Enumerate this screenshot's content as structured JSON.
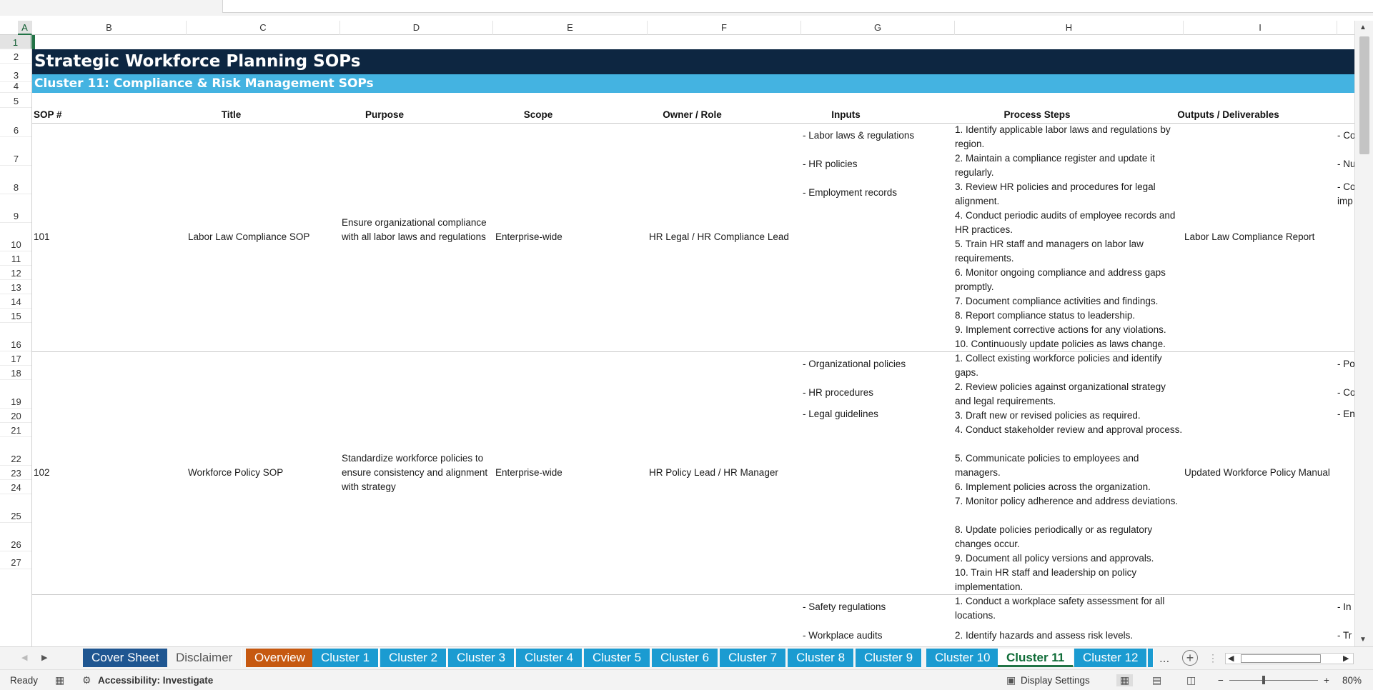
{
  "columns": [
    "A",
    "B",
    "C",
    "D",
    "E",
    "F",
    "G",
    "H",
    "I"
  ],
  "rows": [
    "1",
    "2",
    "3",
    "4",
    "5",
    "6",
    "7",
    "8",
    "9",
    "10",
    "11",
    "12",
    "13",
    "14",
    "15",
    "16",
    "17",
    "18",
    "19",
    "20",
    "21",
    "22",
    "23",
    "24",
    "25",
    "26",
    "27"
  ],
  "sheet": {
    "title": "Strategic Workforce Planning SOPs",
    "subtitle": "Cluster 11: Compliance & Risk Management SOPs",
    "headers": {
      "sop": "SOP #",
      "title": "Title",
      "purpose": "Purpose",
      "scope": "Scope",
      "owner": "Owner / Role",
      "inputs": "Inputs",
      "steps": "Process Steps",
      "outputs": "Outputs / Deliverables"
    },
    "sops": [
      {
        "num": "101",
        "title": "Labor Law Compliance SOP",
        "purpose": "Ensure organizational compliance with all labor laws and regulations",
        "scope": "Enterprise-wide",
        "owner": "HR Legal / HR Compliance Lead",
        "inputs": [
          "- Labor laws & regulations",
          "- HR policies",
          "- Employment records"
        ],
        "steps": [
          "1. Identify applicable labor laws and regulations by region.",
          "2. Maintain a compliance register and update it regularly.",
          "3. Review HR policies and procedures for legal alignment.",
          "4. Conduct periodic audits of employee records and HR practices.",
          "5. Train HR staff and managers on labor law requirements.",
          "6. Monitor ongoing compliance and address gaps promptly.",
          "7. Document compliance activities and findings.",
          "8. Report compliance status to leadership.",
          "9. Implement corrective actions for any violations.",
          "10. Continuously update policies as laws change."
        ],
        "output": "Labor Law Compliance Report",
        "next_col": [
          "- Co",
          "- Nu",
          "- Co",
          "imp"
        ]
      },
      {
        "num": "102",
        "title": "Workforce Policy SOP",
        "purpose": "Standardize workforce policies to ensure consistency and alignment with strategy",
        "scope": "Enterprise-wide",
        "owner": "HR Policy Lead / HR Manager",
        "inputs": [
          "- Organizational policies",
          "- HR procedures",
          "- Legal guidelines"
        ],
        "steps": [
          "1. Collect existing workforce policies and identify gaps.",
          "2. Review policies against organizational strategy and legal requirements.",
          "3. Draft new or revised policies as required.",
          "4. Conduct stakeholder review and approval process.",
          "5. Communicate policies to employees and managers.",
          "6. Implement policies across the organization.",
          "7. Monitor policy adherence and address deviations.",
          "8. Update policies periodically or as regulatory changes occur.",
          "9. Document all policy versions and approvals.",
          "10. Train HR staff and leadership on policy implementation."
        ],
        "output": "Updated Workforce Policy Manual",
        "next_col": [
          "- Po",
          "- Co",
          "- En"
        ]
      },
      {
        "inputs": [
          "- Safety regulations",
          "- Workplace audits"
        ],
        "steps": [
          "1. Conduct a workplace safety assessment for all locations.",
          "2. Identify hazards and assess risk levels."
        ],
        "next_col": [
          "- In",
          "- Tr"
        ]
      }
    ]
  },
  "tabs": [
    "Cover Sheet",
    "Disclaimer",
    "Overview",
    "Cluster 1",
    "Cluster 2",
    "Cluster 3",
    "Cluster 4",
    "Cluster 5",
    "Cluster 6",
    "Cluster 7",
    "Cluster 8",
    "Cluster 9",
    "Cluster 10",
    "Cluster 11",
    "Cluster 12"
  ],
  "active_tab": "Cluster 11",
  "tab_more": "...",
  "status": {
    "ready": "Ready",
    "accessibility": "Accessibility: Investigate",
    "display_settings": "Display Settings",
    "zoom": "80%"
  },
  "colors": {
    "title_band": "#0d2641",
    "subtitle_band": "#44b3e1",
    "cluster_tab": "#1b9bd1",
    "cover_tab": "#1f5691",
    "overview_tab": "#c65911",
    "active_accent": "#217346"
  },
  "icons": {
    "add_sheet": "plus-circle-icon",
    "page_layout": "page-layout-icon",
    "normal_view": "grid-icon"
  }
}
